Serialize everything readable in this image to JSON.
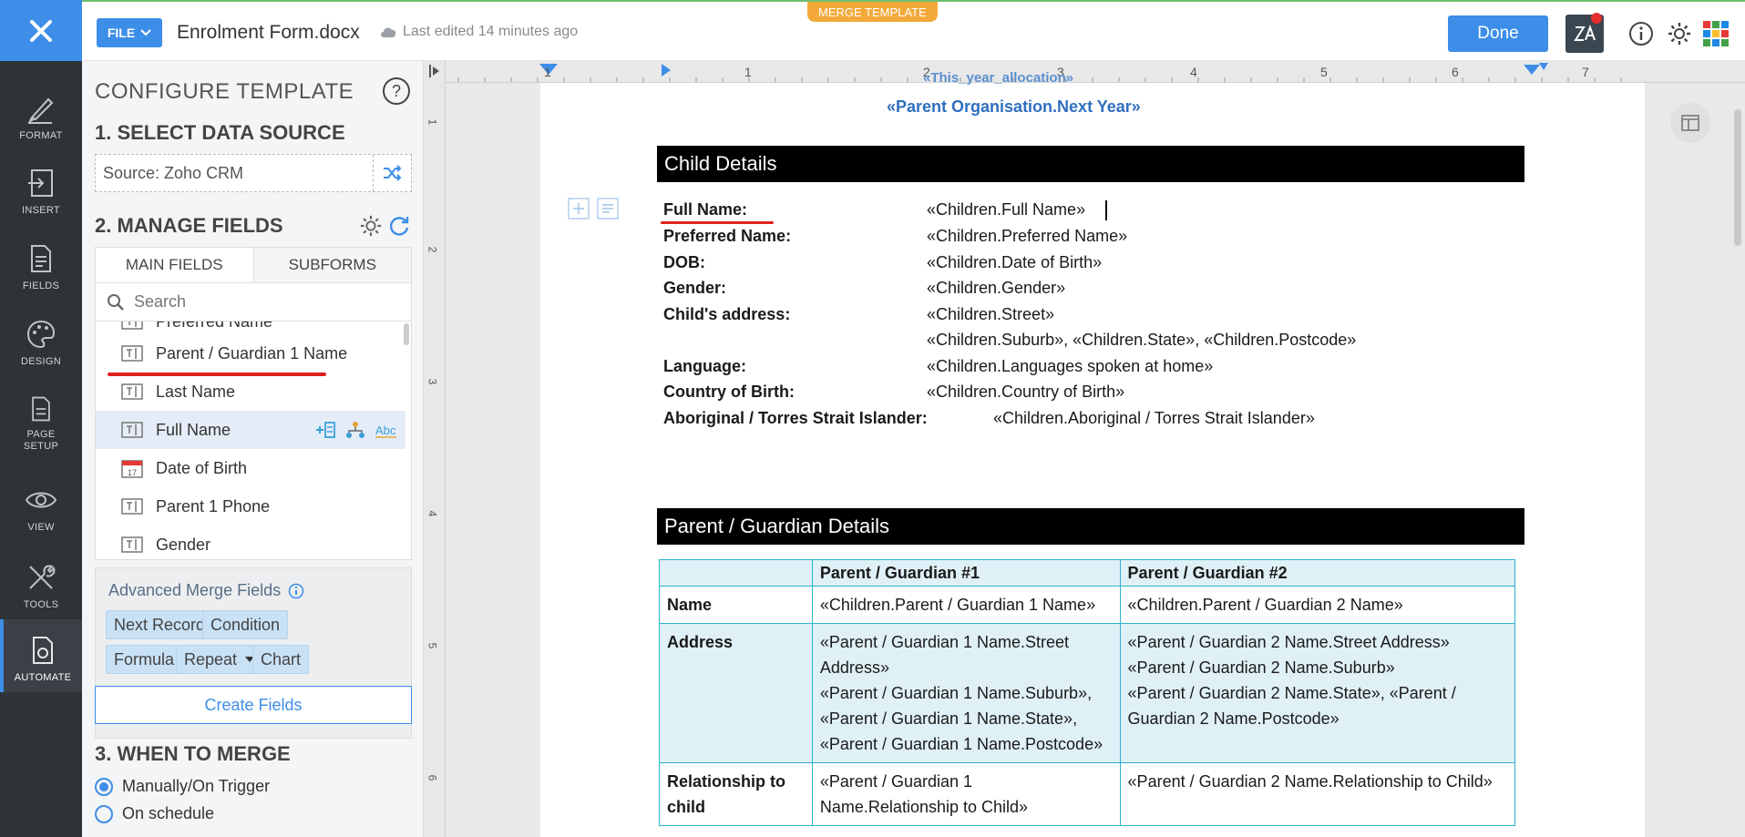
{
  "rail": {
    "items": [
      "FORMAT",
      "INSERT",
      "FIELDS",
      "DESIGN",
      "PAGE SETUP",
      "VIEW",
      "TOOLS",
      "AUTOMATE"
    ]
  },
  "topbar": {
    "file_label": "FILE",
    "doc_title": "Enrolment Form.docx",
    "last_edited": "Last edited 14 minutes ago",
    "merge_tag": "MERGE TEMPLATE",
    "done_label": "Done"
  },
  "panel": {
    "title": "CONFIGURE TEMPLATE",
    "help": "?",
    "step1": "1. SELECT DATA SOURCE",
    "source": "Source:  Zoho CRM",
    "step2": "2. MANAGE FIELDS",
    "tabs": [
      "MAIN FIELDS",
      "SUBFORMS"
    ],
    "search_placeholder": "Search",
    "fields": [
      "Preferred Name",
      "Parent / Guardian 1 Name",
      "Last Name",
      "Full Name",
      "Date of Birth",
      "Parent 1 Phone",
      "Gender"
    ],
    "advanced_title": "Advanced Merge Fields",
    "chips": [
      "Next Record",
      "Condition",
      "Formula",
      "Repeat",
      "Chart"
    ],
    "create_fields": "Create Fields",
    "step3": "3. WHEN TO MERGE",
    "radios": [
      "Manually/On Trigger",
      "On schedule"
    ]
  },
  "ruler": {
    "h": [
      "1",
      "1",
      "2",
      "3",
      "4",
      "5",
      "6",
      "7"
    ],
    "v": [
      "1",
      "2",
      "3",
      "4",
      "5",
      "6"
    ]
  },
  "doc": {
    "top_cut": "«This_year_allocation»",
    "next_year": "«Parent Organisation.Next Year»",
    "child_heading": "Child Details",
    "child_rows": [
      {
        "label": "Full Name:",
        "value": "«Children.Full Name»"
      },
      {
        "label": "Preferred Name:",
        "value": "«Children.Preferred Name»"
      },
      {
        "label": "DOB:",
        "value": "«Children.Date of Birth»"
      },
      {
        "label": "Gender:",
        "value": "«Children.Gender»"
      },
      {
        "label": "Child's address:",
        "value": "«Children.Street»"
      },
      {
        "label": "",
        "value": "«Children.Suburb», «Children.State», «Children.Postcode»"
      },
      {
        "label": "Language:",
        "value": "«Children.Languages spoken at home»"
      },
      {
        "label": "Country of Birth:",
        "value": "«Children.Country of Birth»"
      },
      {
        "label": "Aboriginal / Torres Strait Islander:",
        "value": "«Children.Aboriginal / Torres Strait Islander»"
      }
    ],
    "parent_heading": "Parent / Guardian Details",
    "table": {
      "headers": [
        "",
        "Parent / Guardian #1",
        "Parent / Guardian #2"
      ],
      "name_label": "Name",
      "name_p1": "«Children.Parent / Guardian 1 Name»",
      "name_p2": "«Children.Parent / Guardian 2 Name»",
      "addr_label": "Address",
      "addr_p1_a": "«Parent / Guardian 1 Name.Street Address»",
      "addr_p1_b": "«Parent / Guardian 1 Name.Suburb», «Parent / Guardian 1 Name.State», «Parent / Guardian 1 Name.Postcode»",
      "addr_p2_a": "«Parent / Guardian 2 Name.Street Address»",
      "addr_p2_b": "«Parent / Guardian 2 Name.Suburb»",
      "addr_p2_c": "«Parent / Guardian 2 Name.State», «Parent / Guardian 2 Name.Postcode»",
      "rel_label": "Relationship to child",
      "rel_p1": "«Parent / Guardian 1 Name.Relationship to Child»",
      "rel_p2": "«Parent / Guardian 2 Name.Relationship to Child»"
    }
  },
  "colors": {
    "accent": "#3d8ee8",
    "rail": "#2e3338",
    "merge_tag": "#f3a93a",
    "table_border": "#2bb3cc",
    "table_shade": "#dff0f6",
    "underline": "#e02020"
  }
}
